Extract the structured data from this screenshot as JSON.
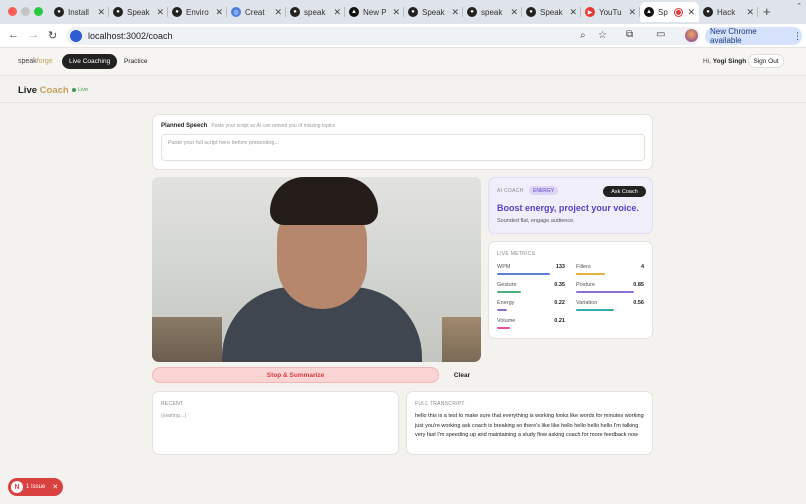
{
  "browser": {
    "tabs": [
      {
        "label": "Install",
        "icon": "github-icon"
      },
      {
        "label": "Speak",
        "icon": "github-icon"
      },
      {
        "label": "Enviro",
        "icon": "github-icon"
      },
      {
        "label": "Creat",
        "icon": "chrome-icon"
      },
      {
        "label": "speak",
        "icon": "github-icon"
      },
      {
        "label": "New P",
        "icon": "vercel-icon"
      },
      {
        "label": "Speak",
        "icon": "github-icon"
      },
      {
        "label": "speak",
        "icon": "github-icon"
      },
      {
        "label": "Speak",
        "icon": "github-icon"
      },
      {
        "label": "YouTu",
        "icon": "youtube-icon"
      },
      {
        "label": "Sp",
        "icon": "vercel-icon",
        "active": true
      },
      {
        "label": "Hack",
        "icon": "github-icon"
      }
    ],
    "url": "localhost:3002/coach",
    "new_chrome": "New Chrome available"
  },
  "app": {
    "brand_first": "speak",
    "brand_second": "forge",
    "nav_active": "Live Coaching",
    "nav_practice": "Practice",
    "greeting": "Hi,",
    "user_name": "Yogi Singh",
    "sign_out": "Sign Out"
  },
  "page": {
    "title_first": "Live",
    "title_second": "Coach",
    "live_badge": "Live"
  },
  "planned": {
    "title": "Planned Speech",
    "hint": "Paste your script so AI can remind you of missing topics",
    "placeholder": "Paste your full script here before presenting..."
  },
  "coach": {
    "label": "AI COACH",
    "badge": "ENERGY",
    "ask": "Ask Coach",
    "headline": "Boost energy, project your voice.",
    "sub": "Sounded flat, engage audience."
  },
  "metrics": {
    "label": "LIVE METRICS",
    "items": [
      {
        "name": "WPM",
        "value": "133",
        "level": 0.78,
        "color": "#5b7fd4"
      },
      {
        "name": "Fillers",
        "value": "4",
        "level": 0.42,
        "color": "#e3b341"
      },
      {
        "name": "Gesture",
        "value": "0.35",
        "level": 0.35,
        "color": "#4caf7d"
      },
      {
        "name": "Posture",
        "value": "0.85",
        "level": 0.85,
        "color": "#8a6fd6"
      },
      {
        "name": "Energy",
        "value": "0.22",
        "level": 0.15,
        "color": "#8a6fd6"
      },
      {
        "name": "Variation",
        "value": "0.56",
        "level": 0.56,
        "color": "#3aa8a8"
      },
      {
        "name": "Volume",
        "value": "0.21",
        "level": 0.19,
        "color": "#e0519a"
      }
    ]
  },
  "controls": {
    "stop": "Stop & Summarize",
    "clear": "Clear"
  },
  "recent": {
    "label": "RECENT",
    "text": "(waiting...)"
  },
  "transcript": {
    "label": "FULL TRANSCRIPT",
    "text": "hello this is a test to make sure that everything is working looks like words for minutes working just you're working  ask coach is breaking  so there's like like hello hello hello hello I'm talking very fast I'm speeding up and maintaining a study flow  asking coach for more feedback now"
  },
  "dev": {
    "issue": "1 Issue"
  },
  "colors": {
    "accent_gold": "#c5a05a",
    "coach_purple": "#5b3fc4",
    "stop_red": "#d63c3c",
    "live_green": "#3a9a55"
  }
}
